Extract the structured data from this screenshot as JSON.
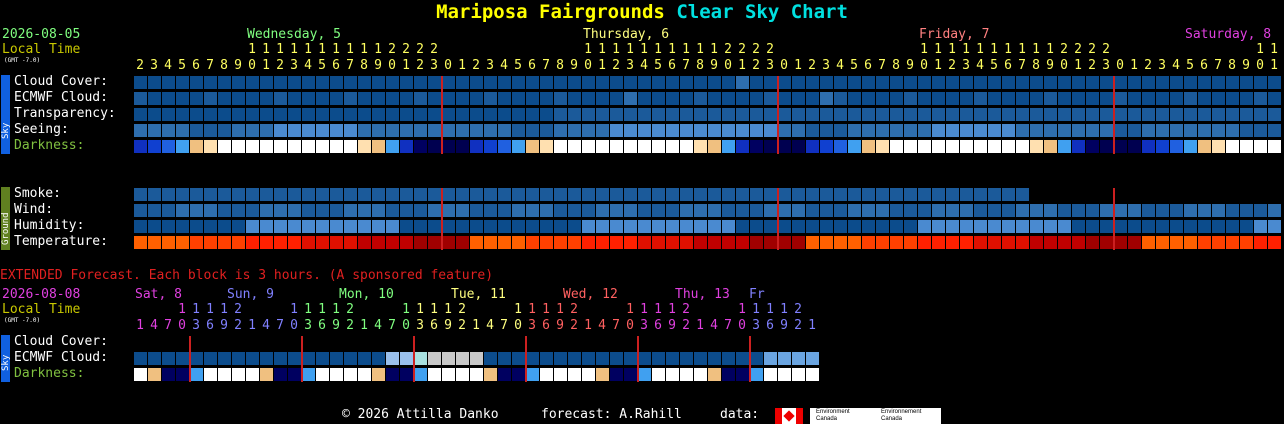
{
  "title": {
    "name": "Mariposa Fairgrounds",
    "chart": "Clear Sky Chart"
  },
  "date": "2026-08-05",
  "local_time": "Local Time",
  "gmt": "(GMT -7.0)",
  "days": [
    {
      "label": "Wednesday, 5",
      "color": "#80ff80"
    },
    {
      "label": "Thursday, 6",
      "color": "#ffff80"
    },
    {
      "label": "Friday, 7",
      "color": "#ff8080"
    },
    {
      "label": "Saturday, 8",
      "color": "#e040e0"
    }
  ],
  "rows": {
    "cloud": "Cloud Cover:",
    "ecmwf": "ECMWF Cloud:",
    "transparency": "Transparency:",
    "seeing": "Seeing:",
    "darkness": "Darkness:",
    "smoke": "Smoke:",
    "wind": "Wind:",
    "humidity": "Humidity:",
    "temperature": "Temperature:"
  },
  "tabs": {
    "sky": "Sky",
    "ground": "Ground"
  },
  "extended": {
    "heading": "EXTENDED Forecast. Each block is 3 hours. (A sponsored feature)",
    "date": "2026-08-08",
    "days": [
      {
        "label": "Sat, 8",
        "color": "#e040e0"
      },
      {
        "label": "Sun, 9",
        "color": "#8080ff"
      },
      {
        "label": "Mon, 10",
        "color": "#80ff80"
      },
      {
        "label": "Tue, 11",
        "color": "#ffff80"
      },
      {
        "label": "Wed, 12",
        "color": "#ff6060"
      },
      {
        "label": "Thu, 13",
        "color": "#e040e0"
      },
      {
        "label": "Fr",
        "color": "#8080ff"
      }
    ]
  },
  "footer": {
    "copyright": "© 2026 Attilla Danko",
    "forecast": "forecast: A.Rahill",
    "data": "data:",
    "env1": "Environment Canada",
    "env2": "Environnement Canada"
  },
  "colors": {
    "cloud_clear": "#003f7f",
    "cloud_mid": "#4a8ad0",
    "cloud_light": "#9ac0ec",
    "midnight_line": "#cc2020",
    "ecmwf_light": "#c8c8c8",
    "ecmwf_teal": "#a8e0e0"
  },
  "chart_data": {
    "type": "table",
    "hours": [
      "2",
      "3",
      "4",
      "5",
      "6",
      "7",
      "8",
      "9",
      "10",
      "11",
      "12",
      "13",
      "14",
      "15",
      "16",
      "17",
      "18",
      "19",
      "20",
      "21",
      "22",
      "23",
      "0",
      "1",
      "2",
      "3",
      "4",
      "5",
      "6",
      "7",
      "8",
      "9",
      "10",
      "11",
      "12",
      "13",
      "14",
      "15",
      "16",
      "17",
      "18",
      "19",
      "20",
      "21",
      "22",
      "23",
      "0",
      "1",
      "2",
      "3",
      "4",
      "5",
      "6",
      "7",
      "8",
      "9",
      "10",
      "11",
      "12",
      "13",
      "14",
      "15",
      "16",
      "17",
      "18",
      "19",
      "20",
      "21",
      "22",
      "23",
      "0",
      "1",
      "2",
      "3",
      "4",
      "5",
      "6",
      "7",
      "8",
      "9",
      "10",
      "11"
    ],
    "ext_hours": [
      "1",
      "4",
      "7",
      "10",
      "13",
      "16",
      "19",
      "22",
      "1",
      "4",
      "7",
      "10",
      "13",
      "16",
      "19",
      "22",
      "1",
      "4",
      "7",
      "10",
      "13",
      "16",
      "19",
      "22",
      "1",
      "4",
      "7",
      "10",
      "13",
      "16",
      "19",
      "22",
      "1",
      "4",
      "7",
      "10",
      "13",
      "16",
      "19",
      "22",
      "1",
      "4",
      "7",
      "10",
      "13",
      "16",
      "19",
      "22",
      "1"
    ]
  }
}
